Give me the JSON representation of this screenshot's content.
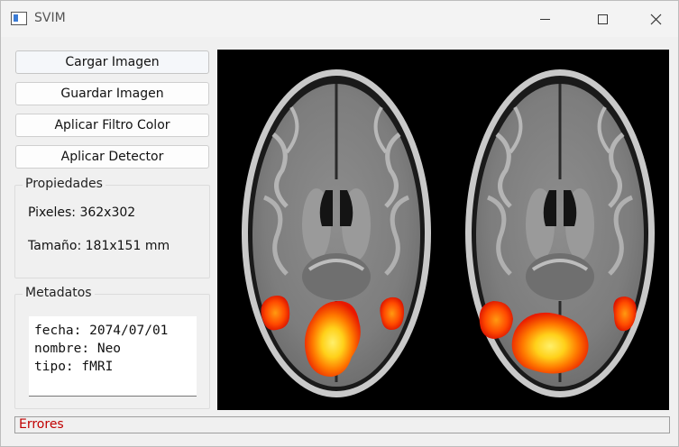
{
  "window": {
    "title": "SVIM"
  },
  "toolbar": {
    "load_label": "Cargar Imagen",
    "save_label": "Guardar Imagen",
    "color_filter_label": "Aplicar Filtro Color",
    "detector_label": "Aplicar Detector"
  },
  "properties": {
    "legend": "Propiedades",
    "pixels": "Pixeles: 362x302",
    "size": "Tamaño: 181x151 mm"
  },
  "metadata": {
    "legend": "Metadatos",
    "lines": [
      "fecha: 2074/07/01",
      "nombre: Neo",
      "tipo: fMRI"
    ]
  },
  "status": {
    "errors_label": "Errores"
  },
  "colors": {
    "error_text": "#c00000",
    "viewer_bg": "#000000",
    "activation_hot": "#ffe53a",
    "activation_mid": "#ff7a00",
    "activation_low": "#ee1c00"
  },
  "icons": {
    "app": "app-window-icon",
    "minimize": "minimize-icon",
    "maximize": "maximize-icon",
    "close": "close-icon"
  }
}
